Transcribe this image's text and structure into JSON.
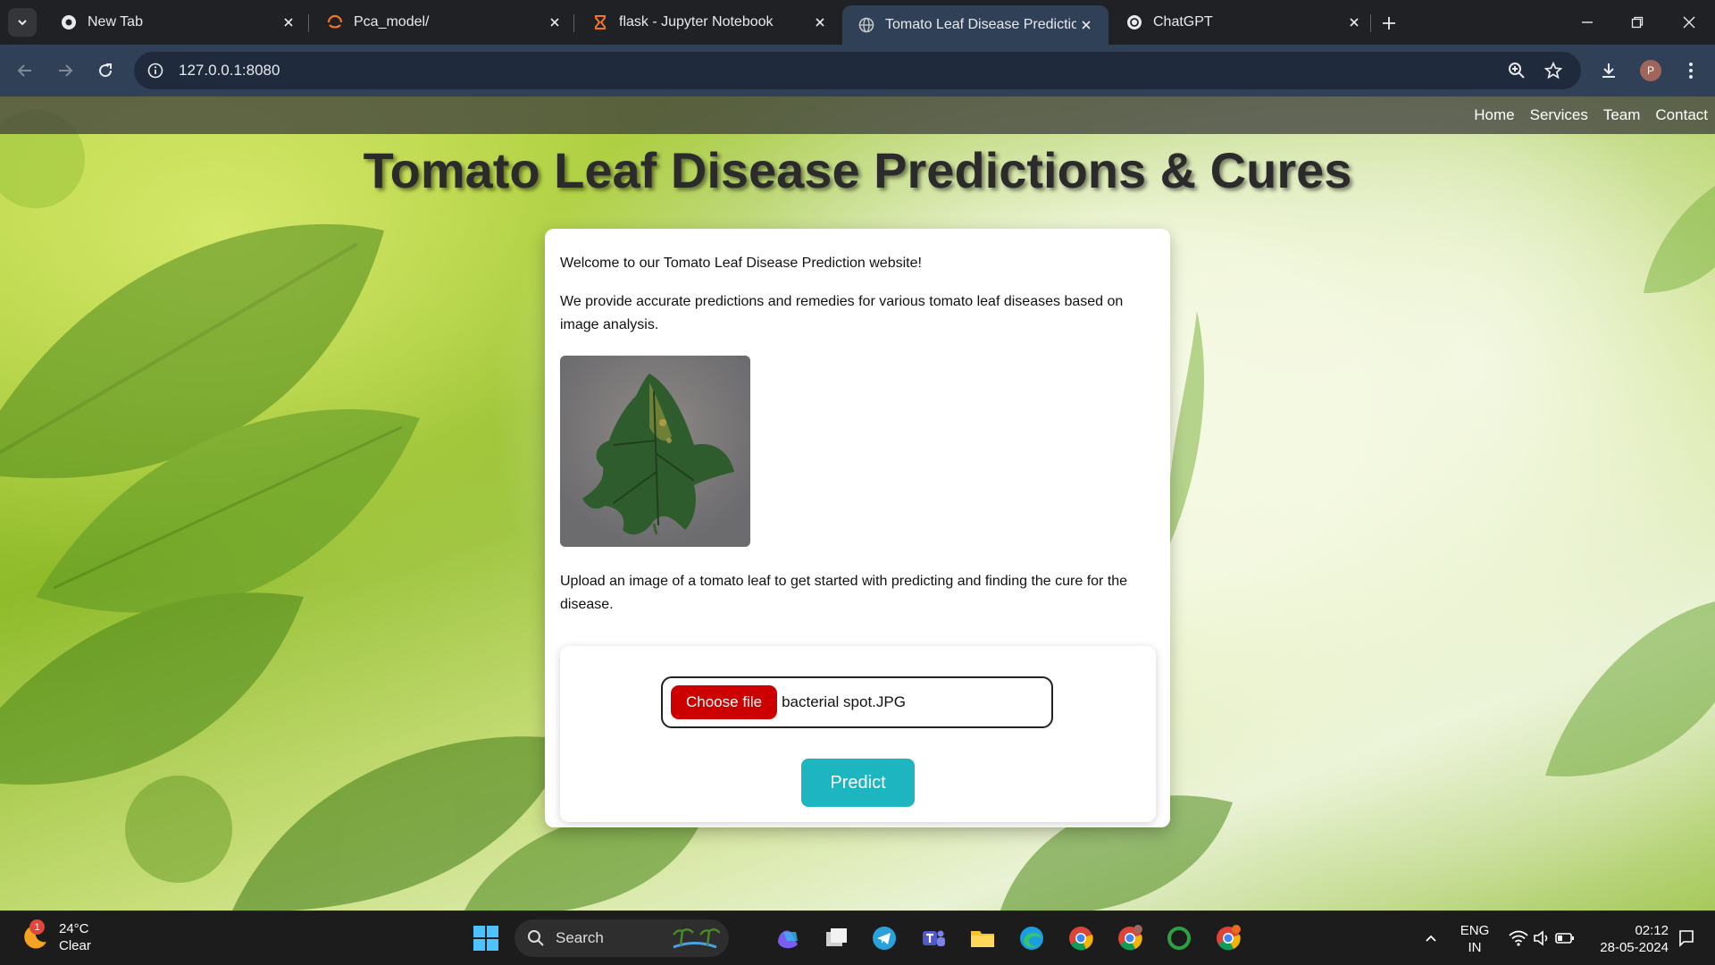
{
  "browser": {
    "tabs": [
      {
        "title": "New Tab",
        "icon": "chrome-icon"
      },
      {
        "title": "Pca_model/",
        "icon": "jupyter-icon"
      },
      {
        "title": "flask - Jupyter Notebook",
        "icon": "hourglass-icon"
      },
      {
        "title": "Tomato Leaf Disease Prediction",
        "icon": "globe-icon",
        "active": true
      },
      {
        "title": "ChatGPT",
        "icon": "openai-icon"
      }
    ],
    "url": "127.0.0.1:8080",
    "profile_initial": "P"
  },
  "site": {
    "nav": [
      "Home",
      "Services",
      "Team",
      "Contact"
    ],
    "headline": "Tomato Leaf Disease Predictions & Cures",
    "intro_1": "Welcome to our Tomato Leaf Disease Prediction website!",
    "intro_2": "We provide accurate predictions and remedies for various tomato leaf diseases based on image analysis.",
    "upload_prompt": "Upload an image of a tomato leaf to get started with predicting and finding the cure for the disease.",
    "choose_file_label": "Choose file",
    "selected_file": "bacterial spot.JPG",
    "predict_label": "Predict",
    "colors": {
      "choose_button": "#cc0000",
      "predict_button": "#1db5c0"
    }
  },
  "taskbar": {
    "weather_badge": "1",
    "temperature": "24°C",
    "condition": "Clear",
    "search_placeholder": "Search",
    "lang_top": "ENG",
    "lang_bottom": "IN",
    "time": "02:12",
    "date": "28-05-2024"
  }
}
